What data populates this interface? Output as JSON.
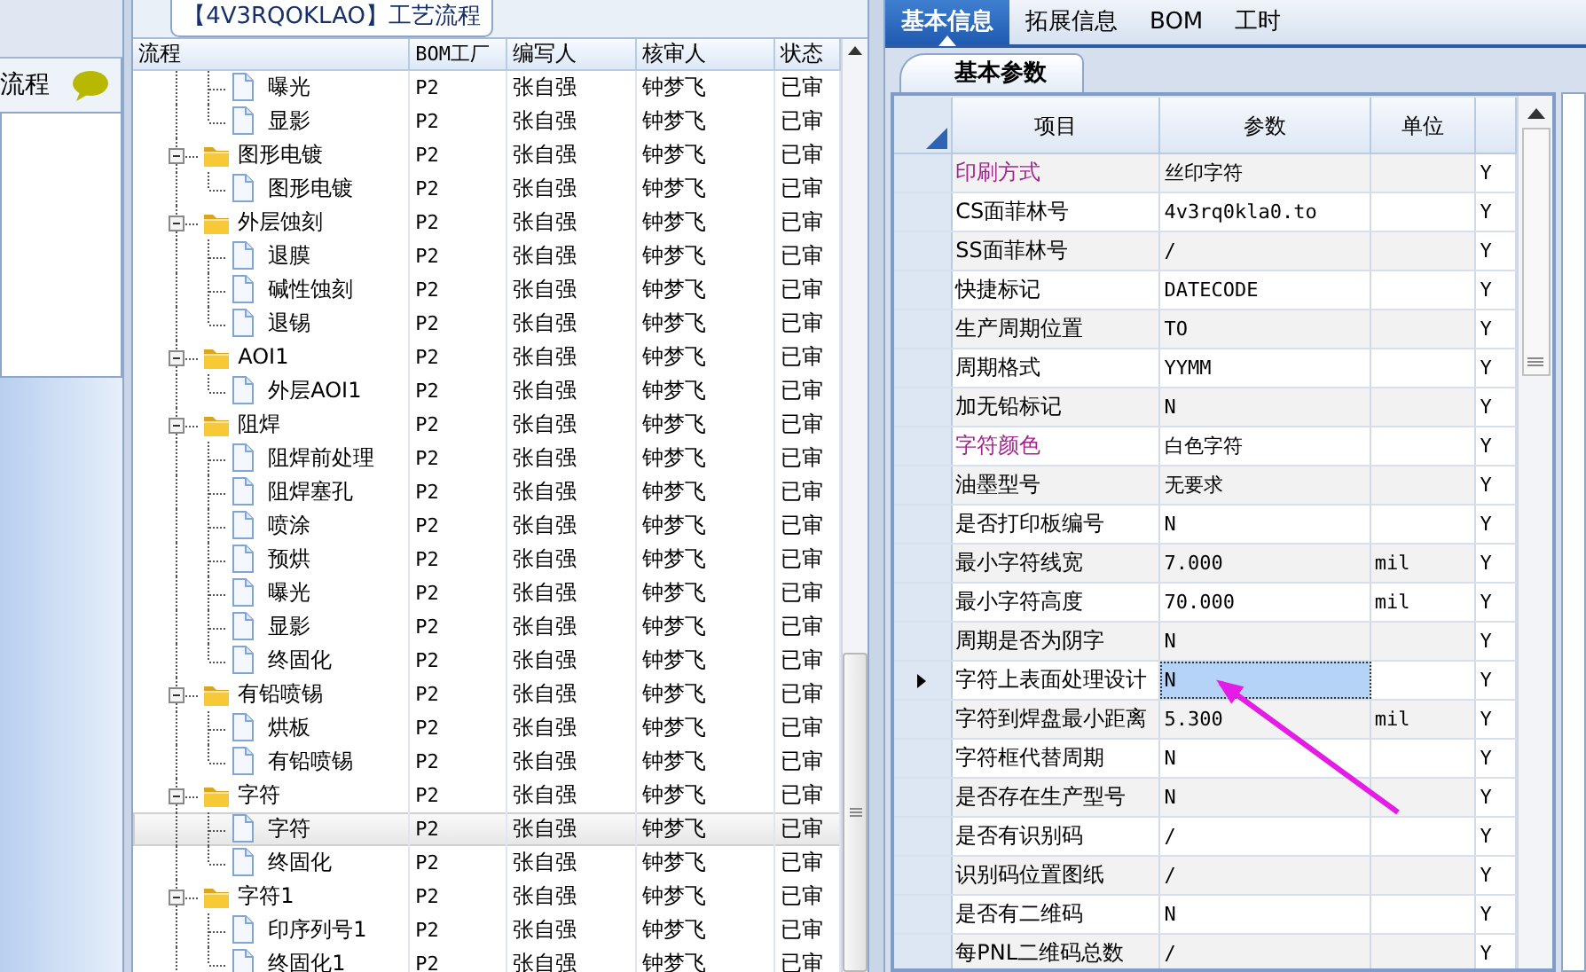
{
  "left_panel": {
    "title": "流程"
  },
  "process_panel": {
    "title": "【4V3RQOKLAO】工艺流程",
    "columns": [
      "流程",
      "BOM工厂",
      "编写人",
      "核审人",
      "状态"
    ],
    "tree": [
      {
        "kind": "step",
        "name": "曝光",
        "bom": "P2",
        "author": "张自强",
        "reviewer": "钟梦飞",
        "status": "已审",
        "selected": false
      },
      {
        "kind": "step",
        "name": "显影",
        "bom": "P2",
        "author": "张自强",
        "reviewer": "钟梦飞",
        "status": "已审",
        "selected": false
      },
      {
        "kind": "folder",
        "name": "图形电镀",
        "bom": "P2",
        "author": "张自强",
        "reviewer": "钟梦飞",
        "status": "已审",
        "selected": false,
        "expanded": true,
        "children": [
          {
            "kind": "step",
            "name": "图形电镀",
            "bom": "P2",
            "author": "张自强",
            "reviewer": "钟梦飞",
            "status": "已审",
            "selected": false
          }
        ]
      },
      {
        "kind": "folder",
        "name": "外层蚀刻",
        "bom": "P2",
        "author": "张自强",
        "reviewer": "钟梦飞",
        "status": "已审",
        "selected": false,
        "expanded": true,
        "children": [
          {
            "kind": "step",
            "name": "退膜",
            "bom": "P2",
            "author": "张自强",
            "reviewer": "钟梦飞",
            "status": "已审",
            "selected": false
          },
          {
            "kind": "step",
            "name": "碱性蚀刻",
            "bom": "P2",
            "author": "张自强",
            "reviewer": "钟梦飞",
            "status": "已审",
            "selected": false
          },
          {
            "kind": "step",
            "name": "退锡",
            "bom": "P2",
            "author": "张自强",
            "reviewer": "钟梦飞",
            "status": "已审",
            "selected": false
          }
        ]
      },
      {
        "kind": "folder",
        "name": "AOI1",
        "bom": "P2",
        "author": "张自强",
        "reviewer": "钟梦飞",
        "status": "已审",
        "selected": false,
        "expanded": true,
        "children": [
          {
            "kind": "step",
            "name": "外层AOI1",
            "bom": "P2",
            "author": "张自强",
            "reviewer": "钟梦飞",
            "status": "已审",
            "selected": false
          }
        ]
      },
      {
        "kind": "folder",
        "name": "阻焊",
        "bom": "P2",
        "author": "张自强",
        "reviewer": "钟梦飞",
        "status": "已审",
        "selected": false,
        "expanded": true,
        "children": [
          {
            "kind": "step",
            "name": "阻焊前处理",
            "bom": "P2",
            "author": "张自强",
            "reviewer": "钟梦飞",
            "status": "已审",
            "selected": false
          },
          {
            "kind": "step",
            "name": "阻焊塞孔",
            "bom": "P2",
            "author": "张自强",
            "reviewer": "钟梦飞",
            "status": "已审",
            "selected": false
          },
          {
            "kind": "step",
            "name": "喷涂",
            "bom": "P2",
            "author": "张自强",
            "reviewer": "钟梦飞",
            "status": "已审",
            "selected": false
          },
          {
            "kind": "step",
            "name": "预烘",
            "bom": "P2",
            "author": "张自强",
            "reviewer": "钟梦飞",
            "status": "已审",
            "selected": false
          },
          {
            "kind": "step",
            "name": "曝光",
            "bom": "P2",
            "author": "张自强",
            "reviewer": "钟梦飞",
            "status": "已审",
            "selected": false
          },
          {
            "kind": "step",
            "name": "显影",
            "bom": "P2",
            "author": "张自强",
            "reviewer": "钟梦飞",
            "status": "已审",
            "selected": false
          },
          {
            "kind": "step",
            "name": "终固化",
            "bom": "P2",
            "author": "张自强",
            "reviewer": "钟梦飞",
            "status": "已审",
            "selected": false
          }
        ]
      },
      {
        "kind": "folder",
        "name": "有铅喷锡",
        "bom": "P2",
        "author": "张自强",
        "reviewer": "钟梦飞",
        "status": "已审",
        "selected": false,
        "expanded": true,
        "children": [
          {
            "kind": "step",
            "name": "烘板",
            "bom": "P2",
            "author": "张自强",
            "reviewer": "钟梦飞",
            "status": "已审",
            "selected": false
          },
          {
            "kind": "step",
            "name": "有铅喷锡",
            "bom": "P2",
            "author": "张自强",
            "reviewer": "钟梦飞",
            "status": "已审",
            "selected": false
          }
        ]
      },
      {
        "kind": "folder",
        "name": "字符",
        "bom": "P2",
        "author": "张自强",
        "reviewer": "钟梦飞",
        "status": "已审",
        "selected": false,
        "expanded": true,
        "children": [
          {
            "kind": "step",
            "name": "字符",
            "bom": "P2",
            "author": "张自强",
            "reviewer": "钟梦飞",
            "status": "已审",
            "selected": true
          },
          {
            "kind": "step",
            "name": "终固化",
            "bom": "P2",
            "author": "张自强",
            "reviewer": "钟梦飞",
            "status": "已审",
            "selected": false
          }
        ]
      },
      {
        "kind": "folder",
        "name": "字符1",
        "bom": "P2",
        "author": "张自强",
        "reviewer": "钟梦飞",
        "status": "已审",
        "selected": false,
        "expanded": true,
        "children": [
          {
            "kind": "step",
            "name": "印序列号1",
            "bom": "P2",
            "author": "张自强",
            "reviewer": "钟梦飞",
            "status": "已审",
            "selected": false
          },
          {
            "kind": "step",
            "name": "终固化1",
            "bom": "P2",
            "author": "张自强",
            "reviewer": "钟梦飞",
            "status": "已审",
            "selected": false
          }
        ]
      }
    ]
  },
  "detail_panel": {
    "tabs": [
      {
        "label": "基本信息",
        "selected": true
      },
      {
        "label": "拓展信息",
        "selected": false
      },
      {
        "label": "BOM",
        "selected": false
      },
      {
        "label": "工时",
        "selected": false
      }
    ],
    "sub_tab": "基本参数",
    "columns": [
      "项目",
      "参数",
      "单位"
    ],
    "rows": [
      {
        "item": "印刷方式",
        "value": "丝印字符",
        "unit": "",
        "column_4": "Y",
        "emphasized": true,
        "selected": false
      },
      {
        "item": "CS面菲林号",
        "value": "4v3rq0kla0.to",
        "unit": "",
        "column_4": "Y",
        "emphasized": false,
        "selected": false
      },
      {
        "item": "SS面菲林号",
        "value": "/",
        "unit": "",
        "column_4": "Y",
        "emphasized": false,
        "selected": false
      },
      {
        "item": "快捷标记",
        "value": "DATECODE",
        "unit": "",
        "column_4": "Y",
        "emphasized": false,
        "selected": false
      },
      {
        "item": "生产周期位置",
        "value": "TO",
        "unit": "",
        "column_4": "Y",
        "emphasized": false,
        "selected": false
      },
      {
        "item": "周期格式",
        "value": "YYMM",
        "unit": "",
        "column_4": "Y",
        "emphasized": false,
        "selected": false
      },
      {
        "item": "加无铅标记",
        "value": "N",
        "unit": "",
        "column_4": "Y",
        "emphasized": false,
        "selected": false
      },
      {
        "item": "字符颜色",
        "value": "白色字符",
        "unit": "",
        "column_4": "Y",
        "emphasized": true,
        "selected": false
      },
      {
        "item": "油墨型号",
        "value": "无要求",
        "unit": "",
        "column_4": "Y",
        "emphasized": false,
        "selected": false
      },
      {
        "item": "是否打印板编号",
        "value": "N",
        "unit": "",
        "column_4": "Y",
        "emphasized": false,
        "selected": false
      },
      {
        "item": "最小字符线宽",
        "value": "7.000",
        "unit": "mil",
        "column_4": "Y",
        "emphasized": false,
        "selected": false
      },
      {
        "item": "最小字符高度",
        "value": "70.000",
        "unit": "mil",
        "column_4": "Y",
        "emphasized": false,
        "selected": false
      },
      {
        "item": "周期是否为阴字",
        "value": "N",
        "unit": "",
        "column_4": "Y",
        "emphasized": false,
        "selected": false
      },
      {
        "item": "字符上表面处理设计",
        "value": "N",
        "unit": "",
        "column_4": "Y",
        "emphasized": false,
        "selected": true
      },
      {
        "item": "字符到焊盘最小距离",
        "value": "5.300",
        "unit": "mil",
        "column_4": "Y",
        "emphasized": false,
        "selected": false
      },
      {
        "item": "字符框代替周期",
        "value": "N",
        "unit": "",
        "column_4": "Y",
        "emphasized": false,
        "selected": false
      },
      {
        "item": "是否存在生产型号",
        "value": "N",
        "unit": "",
        "column_4": "Y",
        "emphasized": false,
        "selected": false
      },
      {
        "item": "是否有识别码",
        "value": "/",
        "unit": "",
        "column_4": "Y",
        "emphasized": false,
        "selected": false
      },
      {
        "item": "识别码位置图纸",
        "value": "/",
        "unit": "",
        "column_4": "Y",
        "emphasized": false,
        "selected": false
      },
      {
        "item": "是否有二维码",
        "value": "N",
        "unit": "",
        "column_4": "Y",
        "emphasized": false,
        "selected": false
      },
      {
        "item": "每PNL二维码总数",
        "value": "/",
        "unit": "",
        "column_4": "Y",
        "emphasized": false,
        "selected": false
      }
    ]
  }
}
